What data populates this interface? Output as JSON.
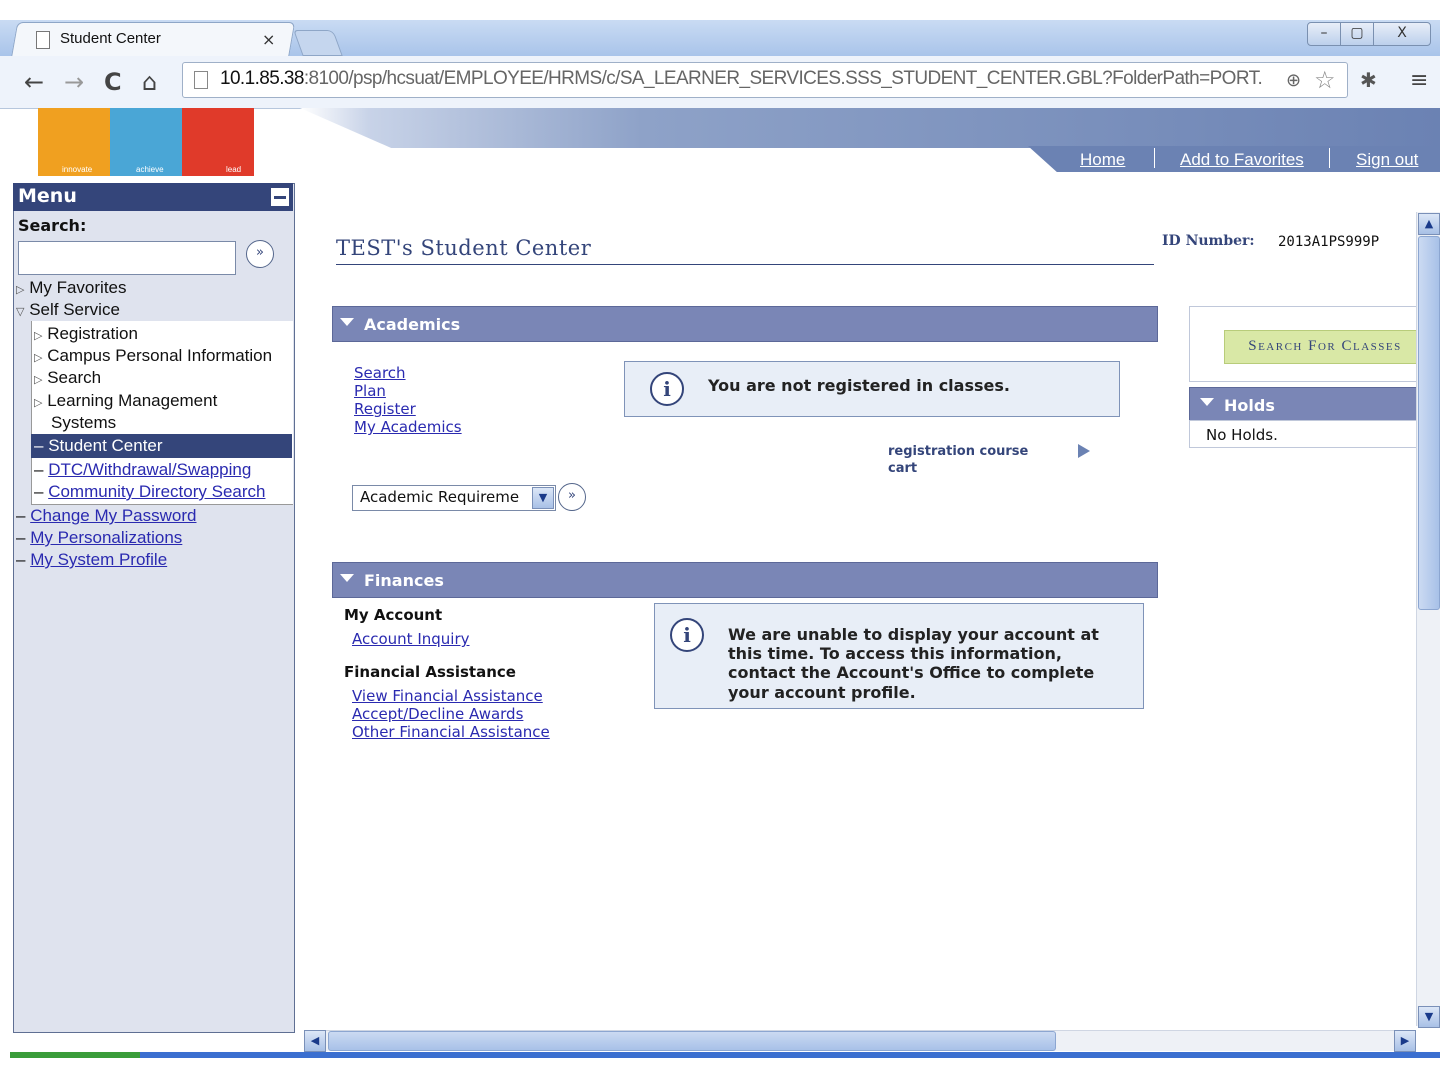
{
  "browser": {
    "tab_title": "Student Center",
    "tab_close": "×",
    "url_host": "10.1.85.38",
    "url_rest": ":8100/psp/hcsuat/EMPLOYEE/HRMS/c/SA_LEARNER_SERVICES.SSS_STUDENT_CENTER.GBL?FolderPath=PORT.",
    "icons": [
      "back-icon",
      "forward-icon",
      "reload-icon",
      "home-icon",
      "zoom-icon",
      "star-icon",
      "extension-icon",
      "menu-icon"
    ],
    "window_buttons": {
      "minimize": "–",
      "maximize": "▢",
      "close": "X"
    }
  },
  "logo": {
    "words": [
      "innovate",
      "achieve",
      "lead"
    ],
    "colors": [
      "#f0a020",
      "#4aa6d6",
      "#e03a2a"
    ]
  },
  "header": {
    "links": {
      "home": "Home",
      "favorites": "Add to Favorites",
      "signout": "Sign out"
    }
  },
  "menu": {
    "title": "Menu",
    "search_label": "Search:",
    "search_value": "",
    "go_symbol": "»",
    "items": {
      "my_favorites": "My Favorites",
      "self_service": "Self Service",
      "registration": "Registration",
      "campus_personal": "Campus Personal Information",
      "search": "Search",
      "lms_line1": "Learning Management",
      "lms_line2": "Systems",
      "student_center": "Student Center",
      "dtc": "DTC/Withdrawal/Swapping",
      "community": "Community Directory Search",
      "change_password": "Change My Password",
      "personalizations": "My Personalizations",
      "system_profile": "My System Profile"
    }
  },
  "page": {
    "title": "TEST's Student Center",
    "id_label": "ID Number:",
    "id_value": "2013A1PS999P"
  },
  "academics": {
    "heading": "Academics",
    "links": [
      "Search",
      "Plan",
      "Register",
      "My Academics"
    ],
    "info_text": "You are not registered in classes.",
    "reg_cart": "registration course cart",
    "select_value": "Academic Requireme",
    "go_symbol": "»"
  },
  "finances": {
    "heading": "Finances",
    "my_account_label": "My Account",
    "account_inquiry": "Account Inquiry",
    "financial_assistance_label": "Financial Assistance",
    "fa_links": [
      "View Financial Assistance",
      "Accept/Decline Awards",
      "Other Financial Assistance"
    ],
    "info_lines": [
      "We are unable to display your account at",
      "this time.  To access this information,",
      "contact the  Account's Office to complete",
      "your account profile."
    ]
  },
  "right_panel": {
    "search_classes_button": "Search For Classes",
    "holds_heading": "Holds",
    "holds_text": "No Holds."
  },
  "colors": {
    "accent": "#34457a",
    "section_bar": "#7a86b6",
    "link": "#2a2ab0",
    "search_button_bg": "#d9e8a6"
  }
}
